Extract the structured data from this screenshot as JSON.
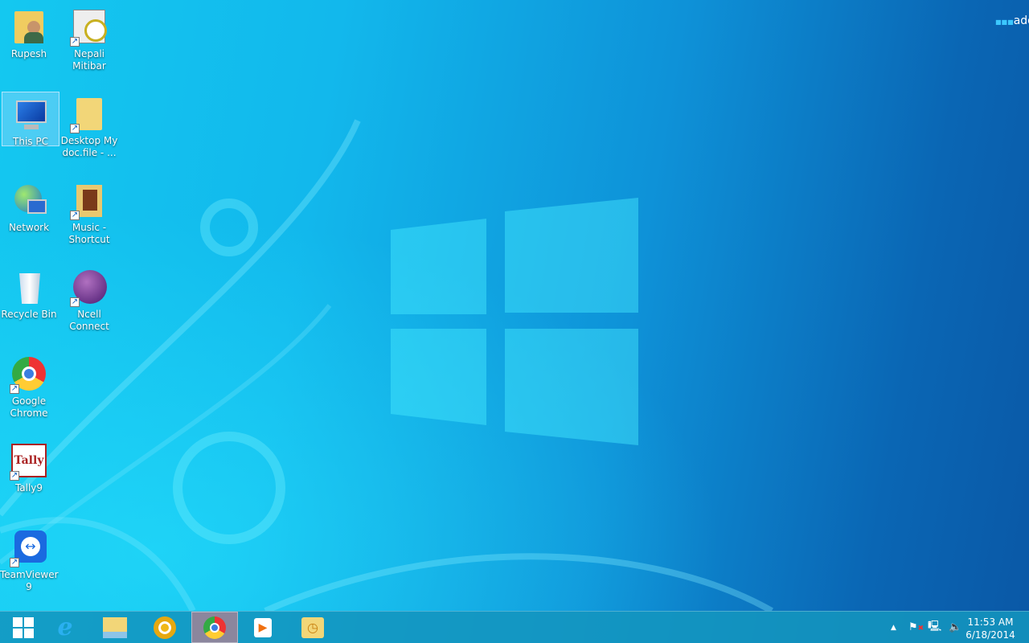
{
  "desktop_icons": [
    {
      "label": "Rupesh",
      "icon": "user-folder-icon"
    },
    {
      "label": "Nepali Mitibar",
      "icon": "calendar-clock-icon"
    },
    {
      "label": "This PC",
      "icon": "computer-icon"
    },
    {
      "label": "Desktop My doc.file - ...",
      "icon": "folder-icon"
    },
    {
      "label": "Network",
      "icon": "network-icon"
    },
    {
      "label": "Music - Shortcut",
      "icon": "music-folder-icon"
    },
    {
      "label": "Recycle Bin",
      "icon": "recycle-bin-icon"
    },
    {
      "label": "Ncell Connect",
      "icon": "ncell-icon"
    },
    {
      "label": "Google Chrome",
      "icon": "chrome-icon"
    },
    {
      "label": "Tally9",
      "icon": "tally-icon"
    },
    {
      "label": "TeamViewer 9",
      "icon": "teamviewer-icon"
    }
  ],
  "notification": {
    "text": "add"
  },
  "taskbar": {
    "apps": [
      "start",
      "internet-explorer",
      "file-explorer",
      "chrome-canary",
      "chrome",
      "media-player",
      "outlook"
    ],
    "clock": {
      "time": "11:53 AM",
      "date": "6/18/2014"
    }
  }
}
